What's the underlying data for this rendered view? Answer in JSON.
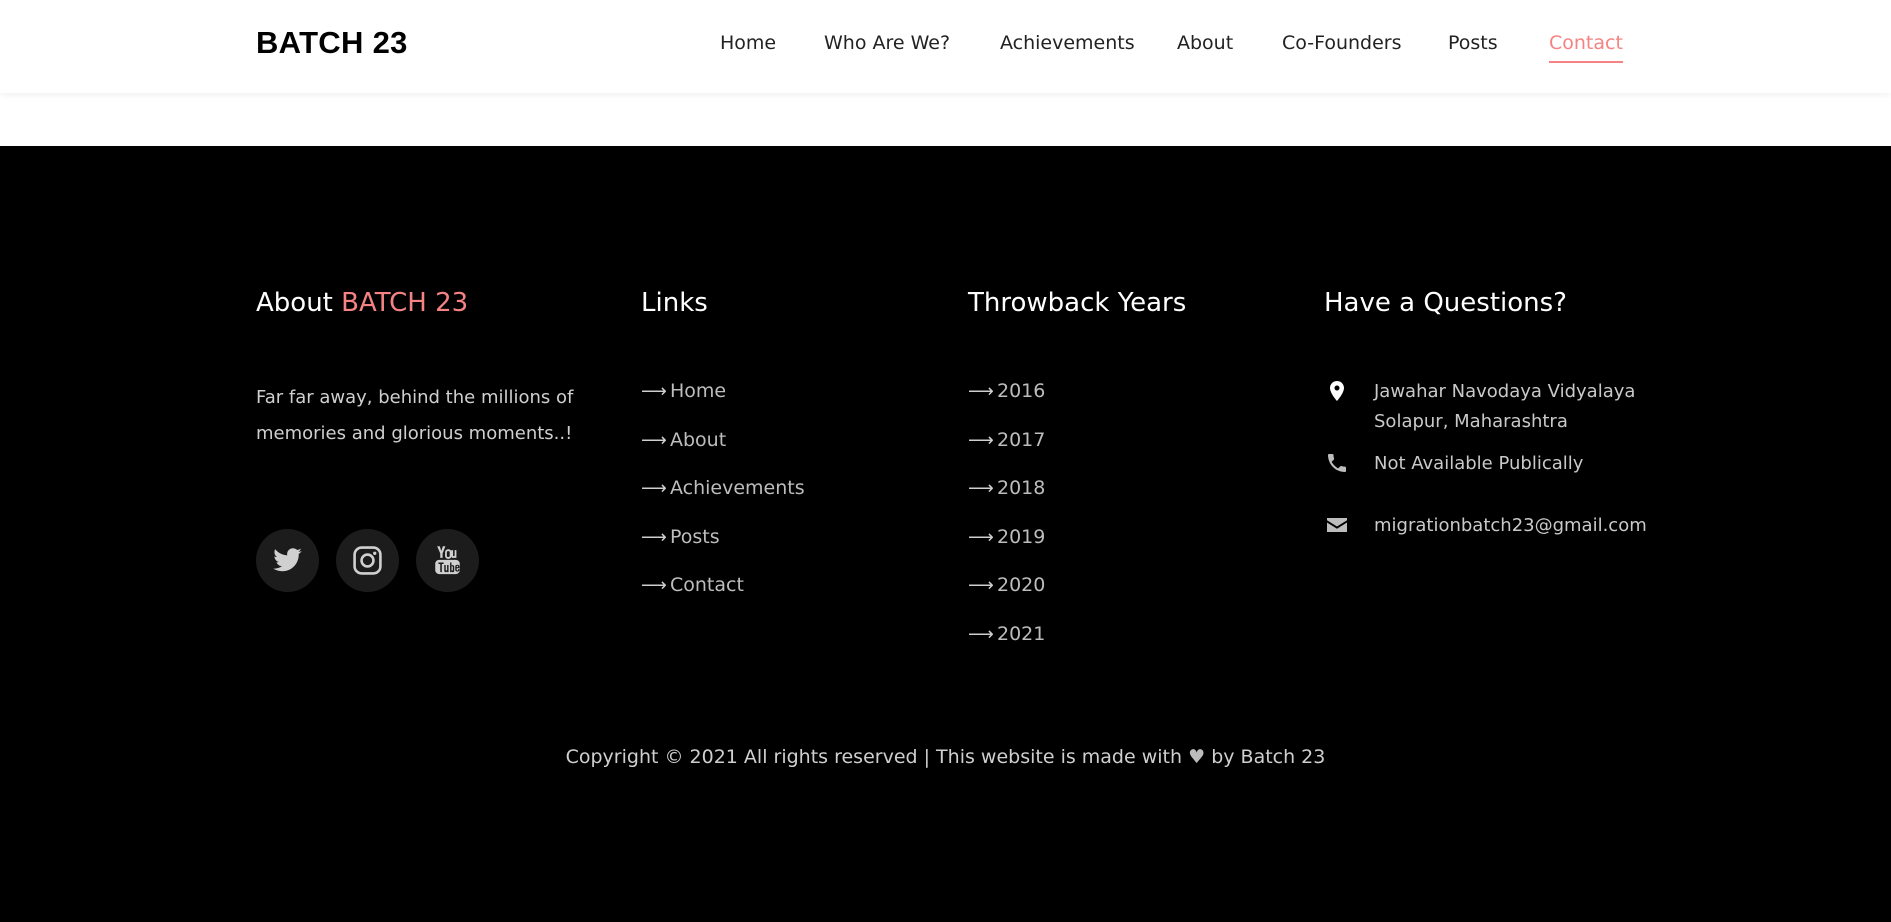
{
  "brand": "BATCH 23",
  "nav": {
    "items": [
      {
        "label": "Home"
      },
      {
        "label": "Who Are We?"
      },
      {
        "label": "Achievements"
      },
      {
        "label": "About"
      },
      {
        "label": "Co-Founders"
      },
      {
        "label": "Posts"
      },
      {
        "label": "Contact",
        "active": true
      }
    ]
  },
  "footer": {
    "about": {
      "title_prefix": "About",
      "title_accent": "BATCH 23",
      "text": "Far far away, behind the millions of memories and glorious moments..!",
      "social": [
        "twitter-icon",
        "instagram-icon",
        "youtube-icon"
      ]
    },
    "links": {
      "title": "Links",
      "items": [
        "Home",
        "About",
        "Achievements",
        "Posts",
        "Contact"
      ]
    },
    "years": {
      "title": "Throwback Years",
      "items": [
        "2016",
        "2017",
        "2018",
        "2019",
        "2020",
        "2021"
      ]
    },
    "contact": {
      "title": "Have a Questions?",
      "address_line1": "Jawahar Navodaya Vidyalaya",
      "address_line2": "Solapur, Maharashtra",
      "phone": "Not Available Publically",
      "email": "migrationbatch23@gmail.com"
    },
    "copyright_prefix": "Copyright © 2021 All rights reserved | This website is made with",
    "copyright_suffix": "by Batch 23"
  },
  "colors": {
    "accent": "#f58383",
    "footer_bg": "#000000",
    "social_bg": "#1c1c1c"
  }
}
